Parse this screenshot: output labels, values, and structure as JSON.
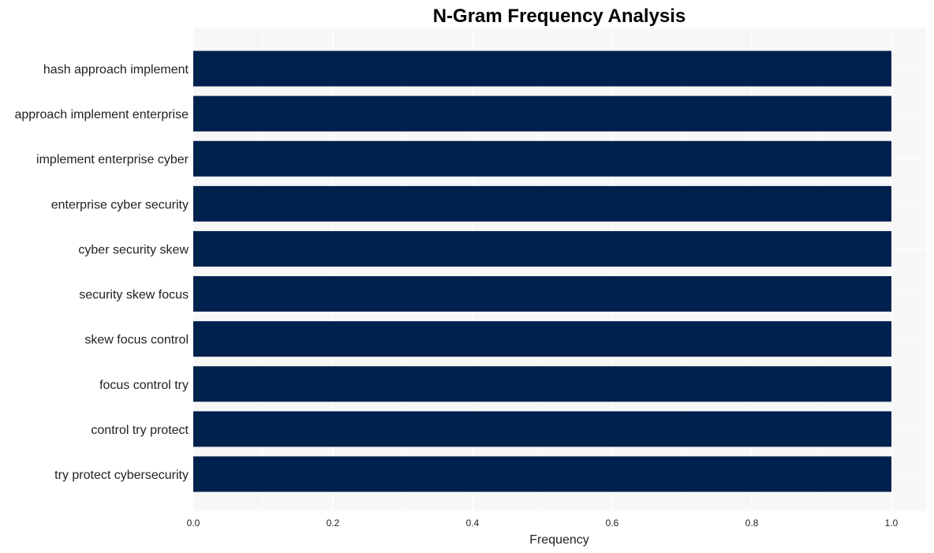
{
  "chart_data": {
    "type": "bar",
    "orientation": "horizontal",
    "title": "N-Gram Frequency Analysis",
    "xlabel": "Frequency",
    "ylabel": "",
    "xlim": [
      0,
      1.05
    ],
    "xticks": [
      "0.0",
      "0.2",
      "0.4",
      "0.6",
      "0.8",
      "1.0"
    ],
    "grid": true,
    "bar_color": "#00214d",
    "background_color": "#f7f7f7",
    "categories": [
      "hash approach implement",
      "approach implement enterprise",
      "implement enterprise cyber",
      "enterprise cyber security",
      "cyber security skew",
      "security skew focus",
      "skew focus control",
      "focus control try",
      "control try protect",
      "try protect cybersecurity"
    ],
    "values": [
      1,
      1,
      1,
      1,
      1,
      1,
      1,
      1,
      1,
      1
    ]
  }
}
